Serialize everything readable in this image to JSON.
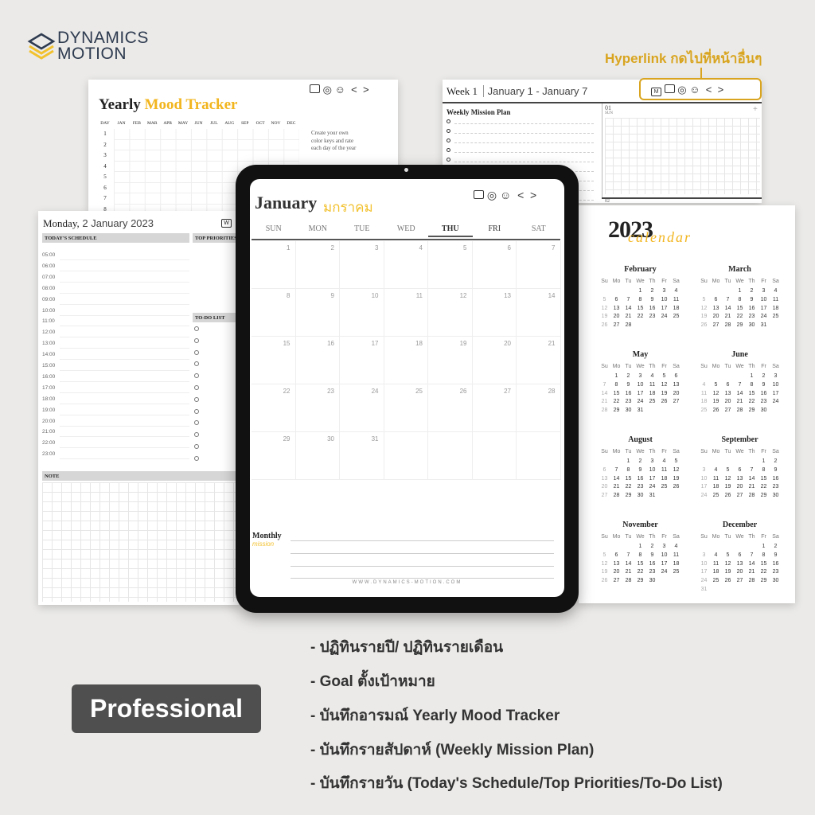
{
  "brand": {
    "line1": "DYNAMICS",
    "line2": "MOTION",
    "colors": {
      "navy": "#2d3a4f",
      "yellow": "#f2c12e"
    }
  },
  "annotation": {
    "hyperlink_label": "Hyperlink กดไปที่หน้าอื่นๆ",
    "color": "#d9a520"
  },
  "nav_icons": [
    "calendar-icon",
    "target-icon",
    "smiley-icon",
    "chevron-left-icon",
    "chevron-right-icon"
  ],
  "mood_tracker": {
    "title_a": "Yearly",
    "title_b": "Mood Tracker",
    "day_header": "DAY",
    "months": [
      "JAN",
      "FEB",
      "MAR",
      "APR",
      "MAY",
      "JUN",
      "JUL",
      "AUG",
      "SEP",
      "OCT",
      "NOV",
      "DEC"
    ],
    "days": [
      "1",
      "2",
      "3",
      "4",
      "5",
      "6",
      "7",
      "8"
    ],
    "note": "Create your own color keys and rate each day of the year"
  },
  "weekly": {
    "week": "Week 1",
    "range": "January 1 - January 7",
    "mission_title": "Weekly Mission Plan",
    "day_num": "01",
    "day_name": "SUN",
    "next_day": "02",
    "plus": "+",
    "m_icon": "M"
  },
  "daily": {
    "title_a": "Monday,",
    "title_b": "2 January 2023",
    "w_icon": "W",
    "schedule": "TODAY'S SCHEDULE",
    "priorities": "TOP PRIORITIES",
    "todo": "TO-DO LIST",
    "note": "NOTE",
    "times": [
      "05:00",
      "06:00",
      "07:00",
      "08:00",
      "09:00",
      "10:00",
      "11:00",
      "12:00",
      "13:00",
      "14:00",
      "15:00",
      "16:00",
      "17:00",
      "18:00",
      "19:00",
      "20:00",
      "21:00",
      "22:00",
      "23:00"
    ],
    "todo_count": 12
  },
  "monthly": {
    "title": "January",
    "title_thai": "มกราคม",
    "weekdays": [
      "SUN",
      "MON",
      "TUE",
      "WED",
      "THU",
      "FRI",
      "SAT"
    ],
    "days": [
      "1",
      "2",
      "3",
      "4",
      "5",
      "6",
      "7",
      "8",
      "9",
      "10",
      "11",
      "12",
      "13",
      "14",
      "15",
      "16",
      "17",
      "18",
      "19",
      "20",
      "21",
      "22",
      "23",
      "24",
      "25",
      "26",
      "27",
      "28",
      "29",
      "30",
      "31"
    ],
    "mission_a": "Monthly",
    "mission_b": "mission",
    "website": "WWW.DYNAMICS-MOTION.COM"
  },
  "year_calendar": {
    "year": "2023",
    "script": "calendar",
    "weekdays": [
      "Su",
      "Mo",
      "Tu",
      "We",
      "Th",
      "Fr",
      "Sa"
    ],
    "months": [
      {
        "name": "February",
        "start": 3,
        "days": 28
      },
      {
        "name": "March",
        "start": 3,
        "days": 31
      },
      {
        "name": "May",
        "start": 1,
        "days": 31
      },
      {
        "name": "June",
        "start": 4,
        "days": 30
      },
      {
        "name": "August",
        "start": 2,
        "days": 31
      },
      {
        "name": "September",
        "start": 5,
        "days": 30
      },
      {
        "name": "November",
        "start": 3,
        "days": 30
      },
      {
        "name": "December",
        "start": 5,
        "days": 31
      }
    ]
  },
  "badge": "Professional",
  "features": [
    "- ปฏิทินรายปี/ ปฏิทินรายเดือน",
    "- Goal ตั้งเป้าหมาย",
    "- บันทึกอารมณ์ Yearly Mood Tracker",
    "- บันทึกรายสัปดาห์ (Weekly Mission Plan)",
    "- บันทึกรายวัน (Today's Schedule/Top Priorities/To-Do List)"
  ]
}
